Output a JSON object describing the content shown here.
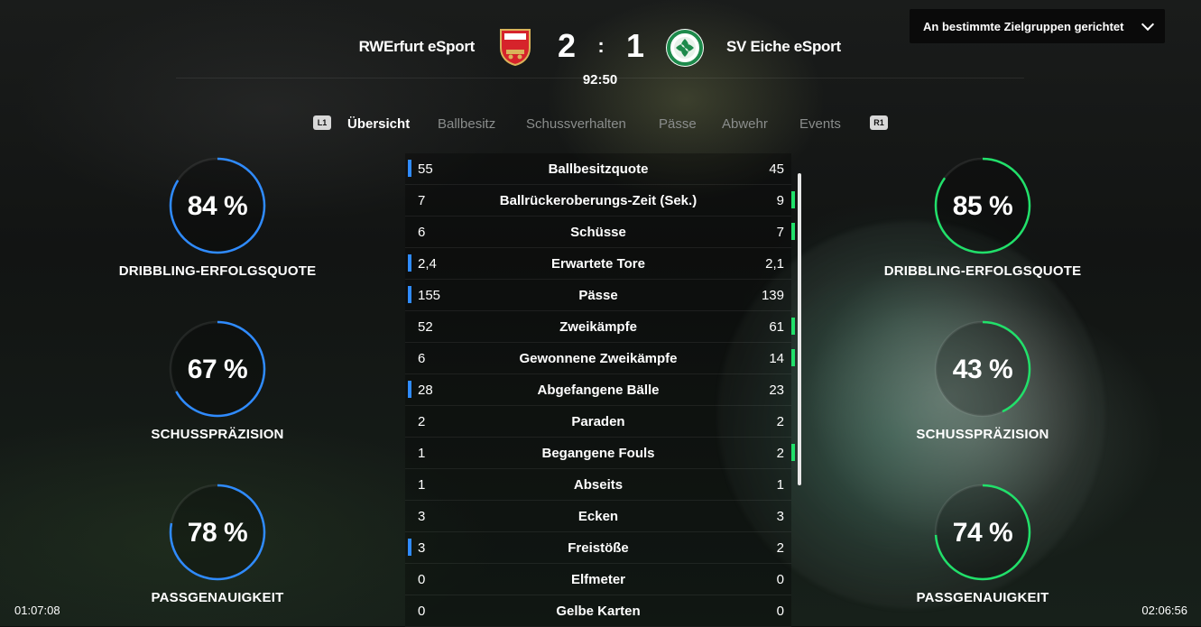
{
  "header": {
    "home_team": "RWErfurt eSport",
    "away_team": "SV Eiche eSport",
    "home_score": "2",
    "separator": ":",
    "away_score": "1",
    "match_time": "92:50"
  },
  "audience_dropdown": {
    "label": "An bestimmte Zielgruppen gerichtet"
  },
  "tabs": {
    "left_hint": "L1",
    "right_hint": "R1",
    "items": [
      "Übersicht",
      "Ballbesitz",
      "Schussverhalten",
      "Pässe",
      "Abwehr",
      "Events"
    ],
    "active": 0
  },
  "colors": {
    "home": "#2f8bff",
    "away": "#21e06a"
  },
  "home_rings": [
    {
      "value": "84 %",
      "pct": 84,
      "label": "DRIBBLING-ERFOLGSQUOTE"
    },
    {
      "value": "67 %",
      "pct": 67,
      "label": "SCHUSSPRÄZISION"
    },
    {
      "value": "78 %",
      "pct": 78,
      "label": "PASSGENAUIGKEIT"
    }
  ],
  "away_rings": [
    {
      "value": "85 %",
      "pct": 85,
      "label": "DRIBBLING-ERFOLGSQUOTE"
    },
    {
      "value": "43 %",
      "pct": 43,
      "label": "SCHUSSPRÄZISION"
    },
    {
      "value": "74 %",
      "pct": 74,
      "label": "PASSGENAUIGKEIT"
    }
  ],
  "stats": [
    {
      "home": "55",
      "label": "Ballbesitzquote",
      "away": "45",
      "lead": "home"
    },
    {
      "home": "7",
      "label": "Ballrückeroberungs-Zeit (Sek.)",
      "away": "9",
      "lead": "away"
    },
    {
      "home": "6",
      "label": "Schüsse",
      "away": "7",
      "lead": "away"
    },
    {
      "home": "2,4",
      "label": "Erwartete Tore",
      "away": "2,1",
      "lead": "home"
    },
    {
      "home": "155",
      "label": "Pässe",
      "away": "139",
      "lead": "home"
    },
    {
      "home": "52",
      "label": "Zweikämpfe",
      "away": "61",
      "lead": "away"
    },
    {
      "home": "6",
      "label": "Gewonnene Zweikämpfe",
      "away": "14",
      "lead": "away"
    },
    {
      "home": "28",
      "label": "Abgefangene Bälle",
      "away": "23",
      "lead": "home"
    },
    {
      "home": "2",
      "label": "Paraden",
      "away": "2",
      "lead": "none"
    },
    {
      "home": "1",
      "label": "Begangene Fouls",
      "away": "2",
      "lead": "away"
    },
    {
      "home": "1",
      "label": "Abseits",
      "away": "1",
      "lead": "none"
    },
    {
      "home": "3",
      "label": "Ecken",
      "away": "3",
      "lead": "none"
    },
    {
      "home": "3",
      "label": "Freistöße",
      "away": "2",
      "lead": "home"
    },
    {
      "home": "0",
      "label": "Elfmeter",
      "away": "0",
      "lead": "none"
    },
    {
      "home": "0",
      "label": "Gelbe Karten",
      "away": "0",
      "lead": "none"
    }
  ],
  "timestamps": {
    "left": "01:07:08",
    "right": "02:06:56"
  }
}
